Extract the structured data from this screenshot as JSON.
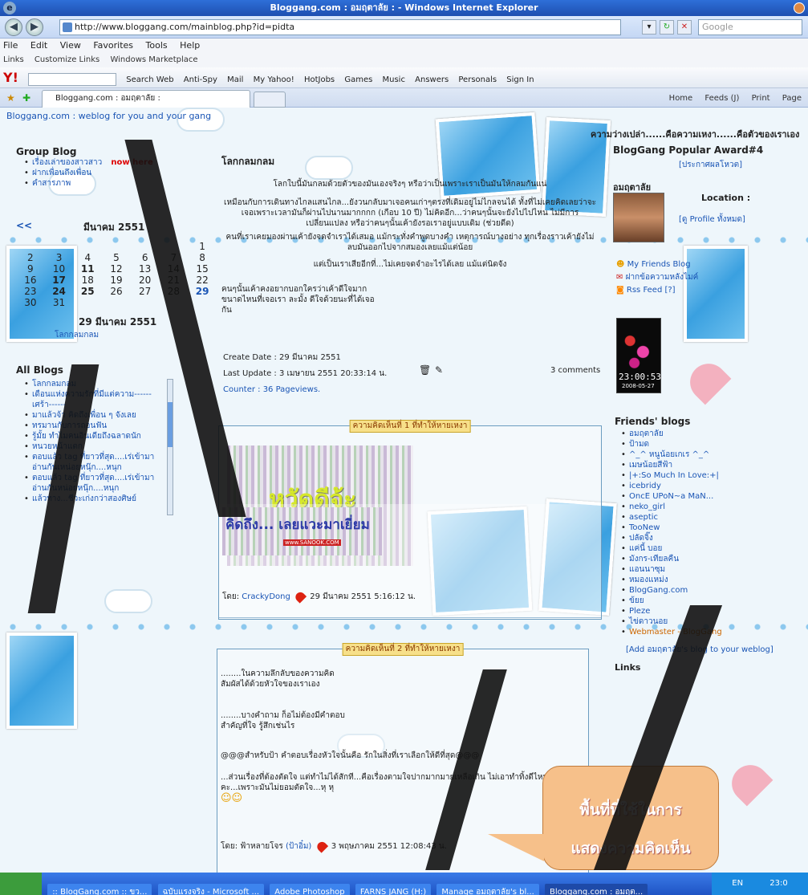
{
  "window": {
    "title": "Bloggang.com : อมฤตาลัย : - Windows Internet Explorer"
  },
  "address": {
    "url": "http://www.bloggang.com/mainblog.php?id=pidta",
    "search_placeholder": "Google"
  },
  "menu": [
    "File",
    "Edit",
    "View",
    "Favorites",
    "Tools",
    "Help"
  ],
  "links_bar": [
    "Links",
    "Customize Links",
    "Windows Marketplace"
  ],
  "toolbar": [
    "Search Web",
    "Anti-Spy",
    "Mail",
    "My Yahoo!",
    "HotJobs",
    "Games",
    "Music",
    "Answers",
    "Personals",
    "Sign In"
  ],
  "tab": {
    "label": "Bloggang.com : อมฤตาลัย :"
  },
  "command_bar": [
    "Home",
    "Feeds (J)",
    "Print",
    "Page"
  ],
  "blog": {
    "header_link": "Bloggang.com : weblog for you and your gang",
    "tagline": "ความว่างเปล่า......คือความเหงา......คือตัวของเราเอง",
    "group_blog": {
      "title": "Group Blog",
      "items": [
        "เรื่องเล่าของสาวสาว",
        "ฝากเพื่อนถึงเพื่อน",
        "คำสารภาพ"
      ],
      "badge": "now here"
    },
    "calendar": {
      "nav": "<<",
      "month": "มีนาคม 2551",
      "rows": [
        [
          "",
          "",
          "",
          "",
          "",
          "",
          "1"
        ],
        [
          "2",
          "3",
          "4",
          "5",
          "6",
          "7",
          "8"
        ],
        [
          "9",
          "10",
          "11",
          "12",
          "13",
          "14",
          "15"
        ],
        [
          "16",
          "17",
          "18",
          "19",
          "20",
          "21",
          "22"
        ],
        [
          "23",
          "24",
          "25",
          "26",
          "27",
          "28",
          "29"
        ],
        [
          "30",
          "31",
          "",
          "",
          "",
          "",
          ""
        ]
      ],
      "current_date": "29 มีนาคม 2551",
      "current_post": "โลกกลมกลม"
    },
    "all_blogs": {
      "title": "All Blogs",
      "items": [
        "โลกกลมกลม",
        "เดือนแห่งความรักที่มีแต่ความ------เศร้า------",
        "มาแล้วจ้า คิดถึงเพื่อน ๆ จังเลย",
        "ทรมานกับการถอนฟัน",
        "รู้มั้ย ทำไมคนอินเดียถึงฉลาดนัก",
        "หนวยหน้าแตก",
        "ตอบแล้ว tag ที่ยาวที่สุด....เร่เข้ามาอ่านกันเหน่อยหนุ๊ก....หนุก",
        "ตอบแล้ว tag ที่ยาวที่สุด....เร่เข้ามาอ่านกันหน่อยหนุ๊ก....หนุก",
        "แล้วทาง...ชีวะเก่งกว่าสองศิษย์"
      ]
    },
    "post": {
      "title": "โลกกลมกลม",
      "paragraphs": [
        "โลกใบนี้มันกลมด้วยตัวของมันเองจริงๆ หรือว่าเป็นเพราะเราเป็นมันให้กลมกันแน่",
        "เหมือนกับการเดินทางไกลแสนไกล...ยังวนกลับมาเจอคนเก่าๆตรงที่เดิมอยู่ไม่ไกลจนได้ ทั้งที่ไม่เคยคิดเลยว่าจะเจอเพราะเวลามันก็ผ่านไปนานมากกกก (เกือบ 10 ปี) ไม่คิดอีก...ว่าคนๆนั้นจะยังไปไปไหน ไม่มีการเปลี่ยนแปลง หรือว่าคนๆนั้นเค้ายังรอเราอยู่แบบเดิม (ช่วยดีด)",
        "คนที่เราเคยมองผ่านเค้ายังจดจำเราได้เสมอ แม้กระทั่งคำพูดบางคำ เหตุการณ์บางอย่าง ทุกเรื่องราวเค้ายังไม่ลบมันออกไปจากสมองเลยแม้แต่น้อย",
        "แต่เป็นเราเสียอีกที่...ไม่เคยจดจำอะไรได้เลย แม้แต่นิดจัง",
        "คนๆนั้นเค้าคงอยากบอกใครว่าเค้าดีใจมากขนาดไหนที่เจอเรา ละมั้ง ดีใจด้วยนะที่ได้เจอกัน"
      ],
      "create_date": "Create Date : 29 มีนาคม 2551",
      "last_update": "Last Update : 3 เมษายน 2551 20:33:14 น.",
      "counter": "Counter : 36 Pageviews.",
      "comments_count": "3 comments"
    },
    "comments": [
      {
        "label": "ความคิดเห็นที่ 1 ที่ทำให้หายเหงา",
        "image_text_1": "หวัดดีจ้ะ",
        "image_text_2": "คิดถึง... เลยแวะมาเยี่ยม",
        "image_credit": "www.SANOOK.COM",
        "by_prefix": "โดย:",
        "author": "CrackyDong",
        "date": "29 มีนาคม 2551 5:16:12 น."
      },
      {
        "label": "ความคิดเห็นที่ 2 ที่ทำให้หายเหงา",
        "lines": [
          "........ในความลึกลับของความคิด",
          "สัมผัสได้ด้วยหัวใจของเราเอง",
          "........บางคำถาม ก็อไม่ต้องมีคำตอบ",
          "สำคัญที่ใจ รู้สึกเช่นไร",
          "@@@สำหรับป้า คำตอบเรื่องหัวใจนั้นคือ รักในสิ่งที่เราเลือกให้ดีที่สุด@@@",
          "...ส่วนเรื่องที่ต้องตัดใจ แต่ทำไม่ได้สักที...คือเรื่องตามใจปากมากมายเหลือเกิน ไม่เอาทำทิ้งดีไหมคะ...เพราะมันไม่ยอมตัดใจ...หุ หุ"
        ],
        "by_prefix": "โดย:",
        "author": "ฟ้าหลายโจร",
        "author_alias": "(ป้าอิ๋ม)",
        "date": "3 พฤษภาคม 2551 12:08:43 น."
      }
    ],
    "right": {
      "award": "BlogGang Popular Award#4",
      "award_link": "[ประกาศผลโหวต]",
      "owner": "อมฤตาลัย",
      "location": "Location :",
      "profile": "[ดู Profile ทั้งหมด]",
      "links": [
        "My Friends Blog",
        "ฝากข้อความหลังไมค์",
        "Rss Feed [?]"
      ],
      "clock_time": "23:00:53",
      "clock_date": "2008-05-27",
      "friends_title": "Friends' blogs",
      "friends": [
        "อมฤตาลัย",
        "ป้ามด",
        "^_^ หนูน้อยเกเร ^_^",
        "เมษน้อยสีฟ้า",
        "|+:So Much In Love:+|",
        "icebridy",
        "OncE UPoN~a MaN...",
        "neko_girl",
        "aseptic",
        "TooNew",
        "ปลัดจิ๊ง",
        "แค่นี้ บอย",
        "มังกร-เทียลคืน",
        "แอนนาซุม",
        "หมองแหม่ง",
        "BlogGang.com",
        "ข้ยย",
        "Pleze",
        "ไข่ดาวนอย",
        "Webmaster - BlogGang"
      ],
      "add_link": "[Add อมฤตาลัย's blog to your weblog]",
      "links_title": "Links"
    },
    "callout": {
      "line1": "พื้นที่ที่ใช้ในการ",
      "line2": "แสดงความคิดเห็น"
    }
  },
  "taskbar": {
    "items": [
      ":: BlogGang.com :: ขว...",
      "ฉบับแรงจริง - Microsoft ...",
      "Adobe Photoshop",
      "FARNS JANG (H:)",
      "Manage อมฤตาลัย's bl...",
      "Bloggang.com : อมฤต..."
    ],
    "lang": "EN",
    "clock": "23:0"
  }
}
